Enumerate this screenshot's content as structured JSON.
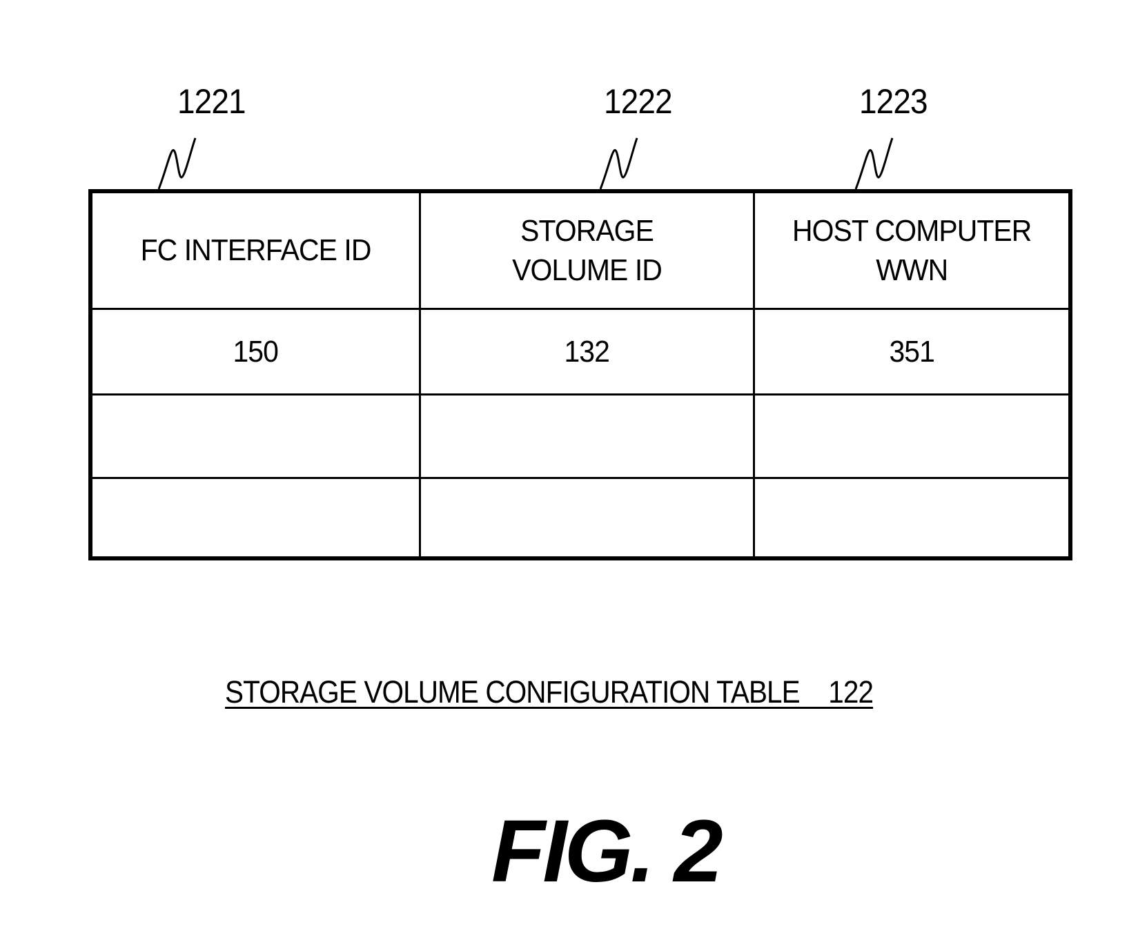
{
  "figure": {
    "label": "FIG. 2",
    "caption": "STORAGE VOLUME CONFIGURATION TABLE    122"
  },
  "reference_numerals": [
    {
      "id": "1221",
      "refers_to": "FC INTERFACE ID column"
    },
    {
      "id": "1222",
      "refers_to": "STORAGE VOLUME ID column"
    },
    {
      "id": "1223",
      "refers_to": "HOST COMPUTER WWN column"
    }
  ],
  "table": {
    "headers": [
      "FC INTERFACE ID",
      "STORAGE\nVOLUME ID",
      "HOST COMPUTER\nWWN"
    ],
    "rows": [
      [
        "150",
        "132",
        "351"
      ],
      [
        "",
        "",
        ""
      ],
      [
        "",
        "",
        ""
      ]
    ]
  }
}
